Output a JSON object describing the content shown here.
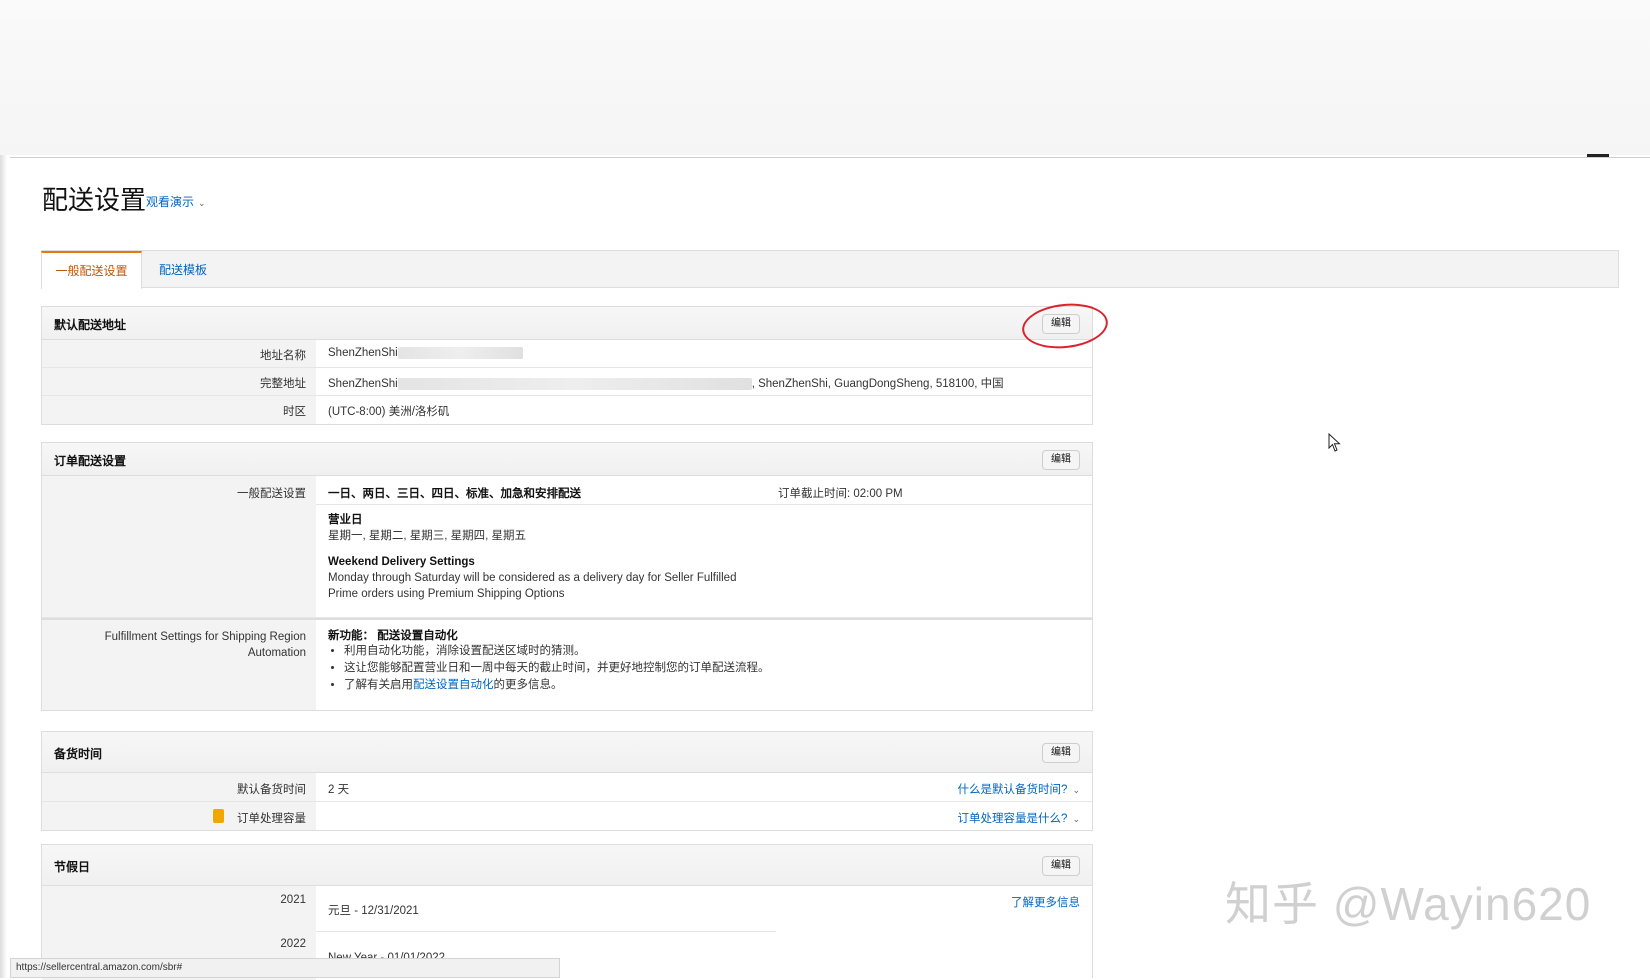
{
  "page": {
    "title": "配送设置",
    "demo_link": "观看演示"
  },
  "tabs": [
    {
      "label": "一般配送设置",
      "active": true
    },
    {
      "label": "配送模板",
      "active": false
    }
  ],
  "default_address": {
    "title": "默认配送地址",
    "edit_label": "编辑",
    "rows": [
      {
        "label": "地址名称",
        "value": "ShenZhenShi"
      },
      {
        "label": "完整地址",
        "value_start": "ShenZhenShi",
        "value_end": ", ShenZhenShi, GuangDongSheng, 518100, 中国"
      },
      {
        "label": "时区",
        "value": "(UTC-8:00) 美洲/洛杉矶"
      }
    ]
  },
  "order_shipping": {
    "title": "订单配送设置",
    "edit_label": "编辑",
    "general_label": "一般配送设置",
    "general_value": "一日、两日、三日、四日、标准、加急和安排配送",
    "cutoff": "订单截止时间: 02:00 PM",
    "business_days_title": "营业日",
    "business_days": "星期一, 星期二, 星期三, 星期四, 星期五",
    "weekend_title": "Weekend Delivery Settings",
    "weekend_line1": "Monday through Saturday will be considered as a delivery day for Seller Fulfilled",
    "weekend_line2": "Prime orders using Premium Shipping Options",
    "automation_label_line1": "Fulfillment Settings for Shipping Region",
    "automation_label_line2": "Automation",
    "automation_title": "新功能： 配送设置自动化",
    "automation_bullets": [
      "利用自动化功能，消除设置配送区域时的猜测。",
      "这让您能够配置营业日和一周中每天的截止时间，并更好地控制您的订单配送流程。"
    ],
    "automation_bullet3_prefix": "了解有关启用",
    "automation_bullet3_link": "配送设置自动化",
    "automation_bullet3_suffix": "的更多信息。"
  },
  "handling_time": {
    "title": "备货时间",
    "edit_label": "编辑",
    "default_label": "默认备货时间",
    "default_value": "2 天",
    "default_help": "什么是默认备货时间?",
    "capacity_label": "订单处理容量",
    "capacity_help": "订单处理容量是什么?"
  },
  "holidays": {
    "title": "节假日",
    "edit_label": "编辑",
    "learn_more": "了解更多信息",
    "years": [
      {
        "year": "2021",
        "value": "元旦 - 12/31/2021"
      },
      {
        "year": "2022",
        "value": "New Year - 01/01/2022"
      }
    ]
  },
  "status_bar": {
    "url": "https://sellercentral.amazon.com/sbr#"
  },
  "watermark": "知乎 @Wayin620"
}
